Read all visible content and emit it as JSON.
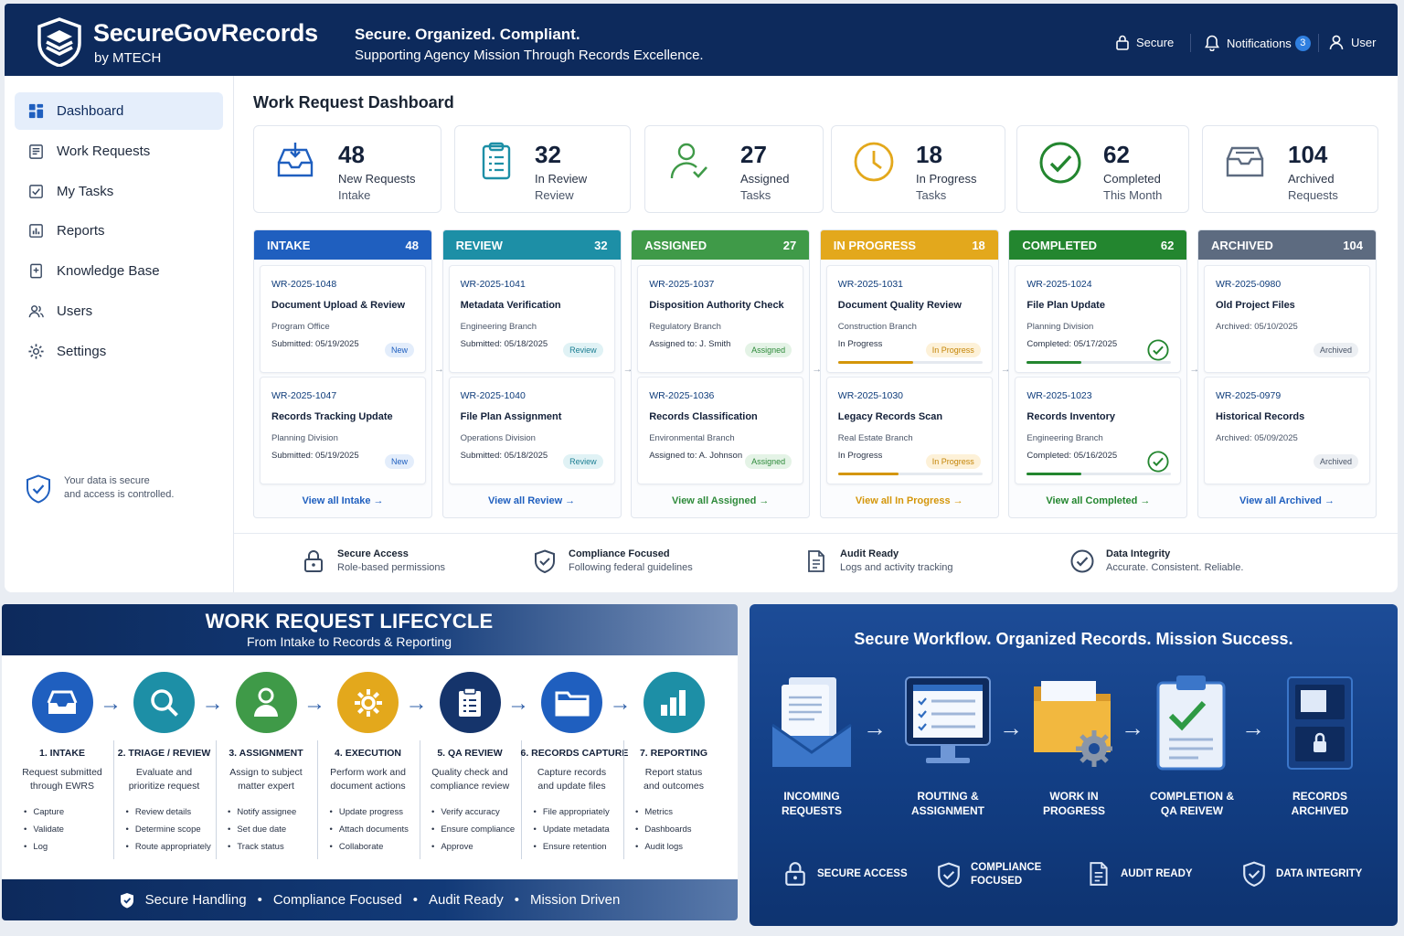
{
  "header": {
    "brand": "SecureGovRecords",
    "brand_sub": "by MTECH",
    "tagline": "Secure. Organized. Compliant.",
    "tagline_sub": "Supporting Agency Mission Through Records Excellence.",
    "secure": "Secure",
    "notifications": "Notifications",
    "notif_count": "3",
    "user": "User"
  },
  "sidebar": {
    "items": [
      {
        "label": "Dashboard",
        "icon": "dashboard-icon"
      },
      {
        "label": "Work Requests",
        "icon": "clipboard-icon"
      },
      {
        "label": "My Tasks",
        "icon": "checkbox-icon"
      },
      {
        "label": "Reports",
        "icon": "bar-chart-icon"
      },
      {
        "label": "Knowledge Base",
        "icon": "book-icon"
      },
      {
        "label": "Users",
        "icon": "users-icon"
      },
      {
        "label": "Settings",
        "icon": "gear-icon"
      }
    ],
    "note_line1": "Your data is secure",
    "note_line2": "and access is controlled."
  },
  "main": {
    "title": "Work Request Dashboard"
  },
  "stats": [
    {
      "num": "48",
      "l1": "New Requests",
      "l2": "Intake"
    },
    {
      "num": "32",
      "l1": "In Review",
      "l2": "Review"
    },
    {
      "num": "27",
      "l1": "Assigned",
      "l2": "Tasks"
    },
    {
      "num": "18",
      "l1": "In Progress",
      "l2": "Tasks"
    },
    {
      "num": "62",
      "l1": "Completed",
      "l2": "This Month"
    },
    {
      "num": "104",
      "l1": "Archived",
      "l2": "Requests"
    }
  ],
  "columns": [
    {
      "name": "INTAKE",
      "count": "48",
      "color": "#1f5fbf",
      "accent": "#1f5fbf",
      "footer": "View all Intake →",
      "cards": [
        {
          "id": "WR-2025-1048",
          "title": "Document Upload & Review",
          "dept": "Program Office",
          "meta": "Submitted: 05/19/2025",
          "pill": "New"
        },
        {
          "id": "WR-2025-1047",
          "title": "Records Tracking Update",
          "dept": "Planning Division",
          "meta": "Submitted: 05/19/2025",
          "pill": "New"
        }
      ]
    },
    {
      "name": "REVIEW",
      "count": "32",
      "color": "#1d8fa6",
      "accent": "#1f5fbf",
      "footer": "View all Review →",
      "cards": [
        {
          "id": "WR-2025-1041",
          "title": "Metadata Verification",
          "dept": "Engineering Branch",
          "meta": "Submitted: 05/18/2025",
          "pill": "Review"
        },
        {
          "id": "WR-2025-1040",
          "title": "File Plan Assignment",
          "dept": "Operations Division",
          "meta": "Submitted: 05/18/2025",
          "pill": "Review"
        }
      ]
    },
    {
      "name": "ASSIGNED",
      "count": "27",
      "color": "#3f9a48",
      "accent": "#2e8a3a",
      "footer": "View all Assigned →",
      "cards": [
        {
          "id": "WR-2025-1037",
          "title": "Disposition Authority Check",
          "dept": "Regulatory Branch",
          "meta": "Assigned to: J. Smith",
          "pill": "Assigned"
        },
        {
          "id": "WR-2025-1036",
          "title": "Records Classification",
          "dept": "Environmental Branch",
          "meta": "Assigned to: A. Johnson",
          "pill": "Assigned"
        }
      ]
    },
    {
      "name": "IN PROGRESS",
      "count": "18",
      "color": "#e3a81c",
      "accent": "#d4960a",
      "footer": "View all In Progress →",
      "cards": [
        {
          "id": "WR-2025-1031",
          "title": "Document Quality Review",
          "dept": "Construction Branch",
          "meta": "In Progress",
          "pill": "In Progress",
          "progress": 0.52
        },
        {
          "id": "WR-2025-1030",
          "title": "Legacy Records Scan",
          "dept": "Real Estate Branch",
          "meta": "In Progress",
          "pill": "In Progress",
          "progress": 0.42
        }
      ]
    },
    {
      "name": "COMPLETED",
      "count": "62",
      "color": "#23862f",
      "accent": "#23862f",
      "footer": "View all Completed →",
      "cards": [
        {
          "id": "WR-2025-1024",
          "title": "File Plan Update",
          "dept": "Planning Division",
          "meta": "Completed: 05/17/2025",
          "pill": "",
          "progress": 0.38
        },
        {
          "id": "WR-2025-1023",
          "title": "Records Inventory",
          "dept": "Engineering Branch",
          "meta": "Completed: 05/16/2025",
          "pill": "",
          "progress": 0.38
        }
      ]
    },
    {
      "name": "ARCHIVED",
      "count": "104",
      "color": "#5d6b80",
      "accent": "#1f5fbf",
      "footer": "View all Archived →",
      "cards": [
        {
          "id": "WR-2025-0980",
          "title": "Old Project Files",
          "dept": "Archived: 05/10/2025",
          "meta": "",
          "pill": "Archived"
        },
        {
          "id": "WR-2025-0979",
          "title": "Historical Records",
          "dept": "Archived: 05/09/2025",
          "meta": "",
          "pill": "Archived"
        }
      ]
    }
  ],
  "features": [
    {
      "t1": "Secure Access",
      "t2": "Role-based permissions",
      "icon": "lock-icon"
    },
    {
      "t1": "Compliance Focused",
      "t2": "Following federal guidelines",
      "icon": "shield-check-icon"
    },
    {
      "t1": "Audit Ready",
      "t2": "Logs and activity tracking",
      "icon": "document-icon"
    },
    {
      "t1": "Data Integrity",
      "t2": "Accurate. Consistent. Reliable.",
      "icon": "check-circle-icon"
    }
  ],
  "lifecycle": {
    "title": "WORK REQUEST LIFECYCLE",
    "subtitle": "From Intake to Records & Reporting",
    "footer": [
      "Secure Handling",
      "•",
      "Compliance Focused",
      "•",
      "Audit Ready",
      "•",
      "Mission Driven"
    ],
    "stages": [
      {
        "name": "1. INTAKE",
        "d1": "Request submitted",
        "d2": "through EWRS",
        "items": [
          "Capture",
          "Validate",
          "Log"
        ],
        "color": "#1f5fbf",
        "icon": "inbox-icon"
      },
      {
        "name": "2. TRIAGE / REVIEW",
        "d1": "Evaluate and",
        "d2": "prioritize request",
        "items": [
          "Review details",
          "Determine scope",
          "Route appropriately"
        ],
        "color": "#1d8fa6",
        "icon": "search-icon"
      },
      {
        "name": "3. ASSIGNMENT",
        "d1": "Assign to subject",
        "d2": "matter expert",
        "items": [
          "Notify assignee",
          "Set due date",
          "Track status"
        ],
        "color": "#3f9a48",
        "icon": "person-icon"
      },
      {
        "name": "4. EXECUTION",
        "d1": "Perform work and",
        "d2": "document actions",
        "items": [
          "Update progress",
          "Attach documents",
          "Collaborate"
        ],
        "color": "#e3a81c",
        "icon": "gear-icon"
      },
      {
        "name": "5. QA REVIEW",
        "d1": "Quality check and",
        "d2": "compliance review",
        "items": [
          "Verify accuracy",
          "Ensure compliance",
          "Approve"
        ],
        "color": "#15346b",
        "icon": "checklist-icon"
      },
      {
        "name": "6. RECORDS CAPTURE",
        "d1": "Capture records",
        "d2": "and update files",
        "items": [
          "File appropriately",
          "Update metadata",
          "Ensure retention"
        ],
        "color": "#1f5fbf",
        "icon": "folder-icon"
      },
      {
        "name": "7. REPORTING",
        "d1": "Report status",
        "d2": "and outcomes",
        "items": [
          "Metrics",
          "Dashboards",
          "Audit logs"
        ],
        "color": "#1d8fa6",
        "icon": "bar-chart-icon"
      }
    ]
  },
  "workflow": {
    "title": "Secure Workflow. Organized Records. Mission Success.",
    "steps": [
      {
        "l1": "INCOMING",
        "l2": "REQUESTS"
      },
      {
        "l1": "ROUTING &",
        "l2": "ASSIGNMENT"
      },
      {
        "l1": "WORK IN",
        "l2": "PROGRESS"
      },
      {
        "l1": "COMPLETION &",
        "l2": "QA REIVEW"
      },
      {
        "l1": "RECORDS",
        "l2": "ARCHIVED"
      }
    ],
    "features": [
      {
        "l1": "SECURE ACCESS",
        "l2": ""
      },
      {
        "l1": "COMPLIANCE",
        "l2": "FOCUSED"
      },
      {
        "l1": "AUDIT READY",
        "l2": ""
      },
      {
        "l1": "DATA INTEGRITY",
        "l2": ""
      }
    ]
  }
}
